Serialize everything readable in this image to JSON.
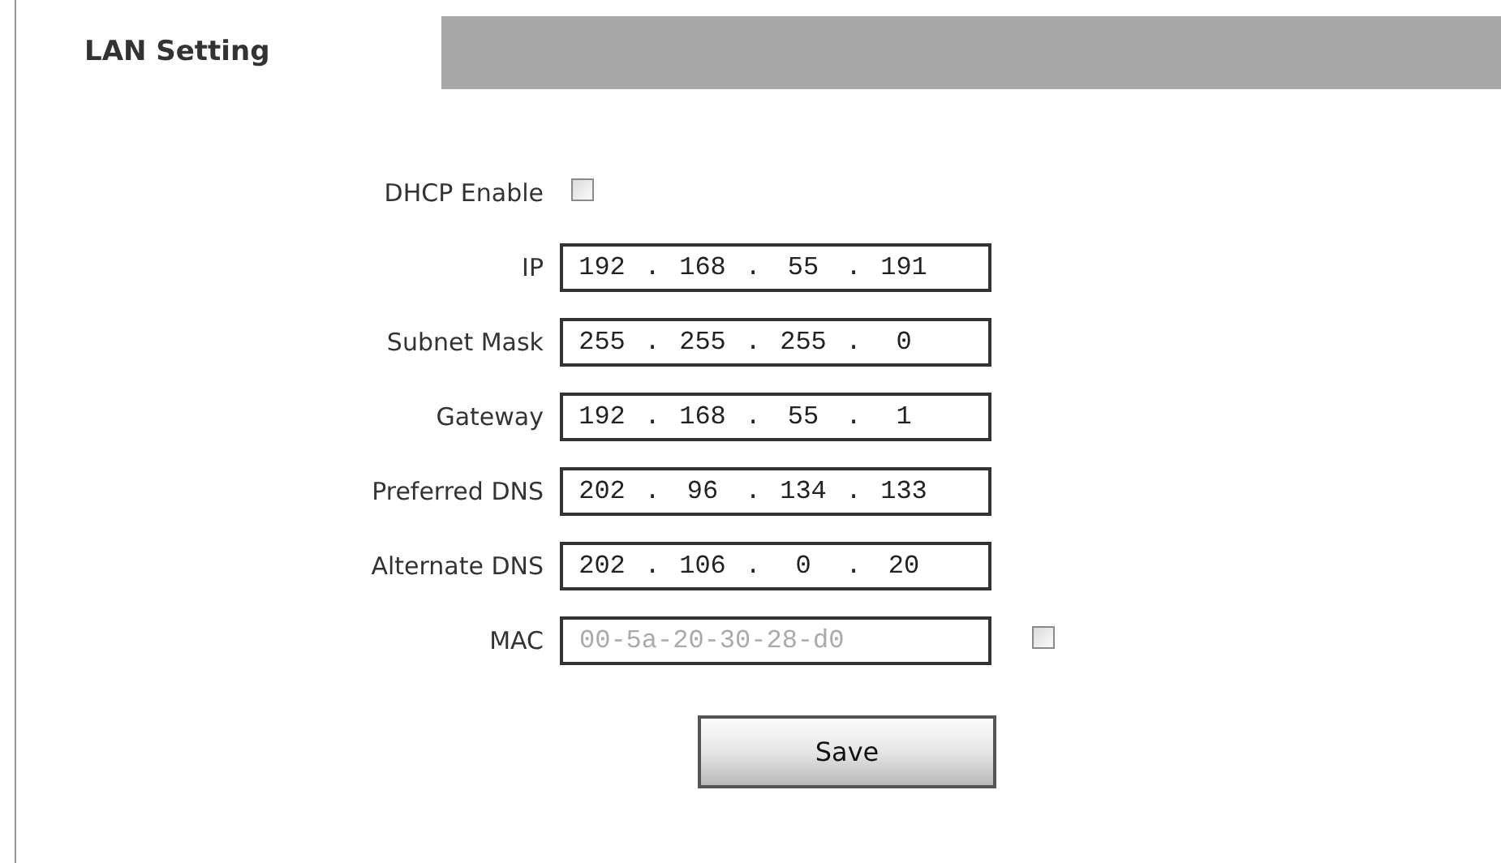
{
  "title": "LAN Setting",
  "fields": [
    {
      "kind": "checkbox",
      "label": "DHCP Enable",
      "checked": false
    },
    {
      "kind": "ip",
      "label": "IP",
      "octets": [
        "192",
        "168",
        "55",
        "191"
      ],
      "separator": "."
    },
    {
      "kind": "ip",
      "label": "Subnet Mask",
      "octets": [
        "255",
        "255",
        "255",
        "0"
      ],
      "separator": "."
    },
    {
      "kind": "ip",
      "label": "Gateway",
      "octets": [
        "192",
        "168",
        "55",
        "1"
      ],
      "separator": "."
    },
    {
      "kind": "ip",
      "label": "Preferred DNS",
      "octets": [
        "202",
        "96",
        "134",
        "133"
      ],
      "separator": "."
    },
    {
      "kind": "ip",
      "label": "Alternate DNS",
      "octets": [
        "202",
        "106",
        "0",
        "20"
      ],
      "separator": "."
    },
    {
      "kind": "mac",
      "label": "MAC",
      "value": "00-5a-20-30-28-d0",
      "disabled": true,
      "checked": false
    }
  ],
  "save_button": "Save"
}
